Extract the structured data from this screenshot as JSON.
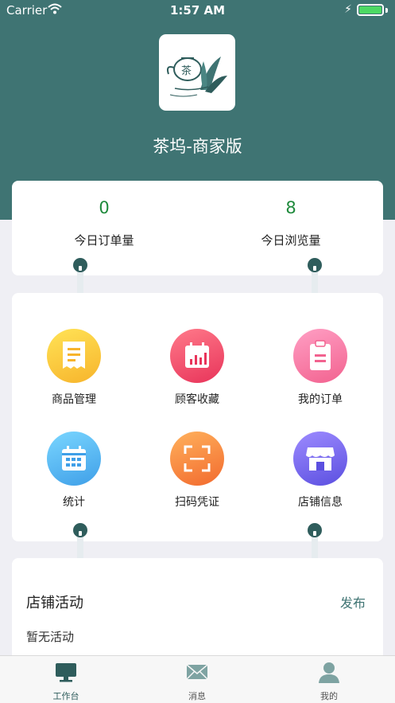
{
  "status_bar": {
    "carrier": "Carrier",
    "time": "1:57 AM"
  },
  "header": {
    "app_title": "茶坞-商家版",
    "logo_icon": "tea-logo-icon",
    "background": "#3f7473"
  },
  "stats": [
    {
      "value": "0",
      "label": "今日订单量"
    },
    {
      "value": "8",
      "label": "今日浏览量"
    }
  ],
  "menu": [
    {
      "label": "商品管理",
      "icon": "receipt-icon"
    },
    {
      "label": "顾客收藏",
      "icon": "calendar-chart-icon"
    },
    {
      "label": "我的订单",
      "icon": "clipboard-icon"
    },
    {
      "label": "统计",
      "icon": "calendar-icon"
    },
    {
      "label": "扫码凭证",
      "icon": "scan-icon"
    },
    {
      "label": "店铺信息",
      "icon": "store-icon"
    }
  ],
  "activity": {
    "title": "店铺活动",
    "publish_label": "发布",
    "empty_text": "暂无活动"
  },
  "tabs": [
    {
      "label": "工作台",
      "icon": "desktop-icon",
      "active": true
    },
    {
      "label": "消息",
      "icon": "mail-icon",
      "active": false
    },
    {
      "label": "我的",
      "icon": "person-icon",
      "active": false
    }
  ],
  "colors": {
    "accent": "#3f7473",
    "stat_value": "#1f8a3c"
  }
}
